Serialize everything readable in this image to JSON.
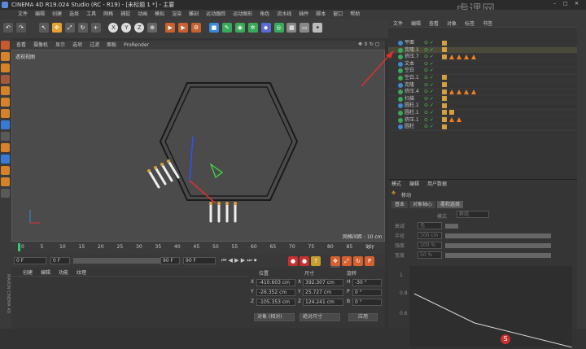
{
  "app": {
    "title": "CINEMA 4D R19.024 Studio (RC - R19) - [未标题 1 *] - 主要"
  },
  "watermark": "虎课网",
  "menu": [
    "文件",
    "编辑",
    "创建",
    "选择",
    "工具",
    "网格",
    "捕捉",
    "动画",
    "模拟",
    "渲染",
    "雕刻",
    "运动跟踪",
    "运动图形",
    "角色",
    "流水线",
    "插件",
    "脚本",
    "窗口",
    "帮助"
  ],
  "viewport": {
    "menu": [
      "查看",
      "摄像机",
      "显示",
      "选项",
      "过滤",
      "面板",
      "ProRender"
    ],
    "label": "透视视图",
    "grid_label": "网格间距 : 10 cm"
  },
  "timeline": {
    "ticks": [
      "0",
      "5",
      "10",
      "15",
      "20",
      "25",
      "30",
      "35",
      "40",
      "45",
      "50",
      "55",
      "60",
      "65",
      "70",
      "75",
      "80",
      "85",
      "90"
    ],
    "right_label": "0 F"
  },
  "playbar": {
    "start": "0 F",
    "current": "0 F",
    "end": "90 F",
    "end2": "90 F"
  },
  "materials": {
    "tabs": [
      "创建",
      "编辑",
      "功能",
      "纹理"
    ]
  },
  "coords": {
    "headers": [
      "位置",
      "尺寸",
      "旋转"
    ],
    "rows": [
      {
        "axis": "X",
        "pos": "-410.603 cm",
        "size": "392.307 cm",
        "rot_axis": "H",
        "rot": "-30 °"
      },
      {
        "axis": "Y",
        "pos": "-26.352 cm",
        "size": "25.727 cm",
        "rot_axis": "P",
        "rot": "0 °"
      },
      {
        "axis": "Z",
        "pos": "-105.353 cm",
        "size": "124.241 cm",
        "rot_axis": "B",
        "rot": "0 °"
      }
    ],
    "mode": "对象 (相对)",
    "size_mode": "绝对尺寸",
    "apply": "应用"
  },
  "objects": {
    "tabs": [
      "文件",
      "编辑",
      "查看",
      "对象",
      "标签",
      "书签"
    ],
    "rows": [
      {
        "name": "平面",
        "tags": "chk"
      },
      {
        "name": "克隆.1",
        "tags": "chk"
      },
      {
        "name": "挤压.7",
        "tags": "tri4"
      },
      {
        "name": "文本",
        "tags": ""
      },
      {
        "name": "空白",
        "tags": ""
      },
      {
        "name": "空白.1",
        "tags": "chk"
      },
      {
        "name": "克隆",
        "tags": "chk"
      },
      {
        "name": "挤压.4",
        "tags": "tri4"
      },
      {
        "name": "扫描",
        "tags": "chk"
      },
      {
        "name": "圆柱.1",
        "tags": "chk"
      },
      {
        "name": "圆柱.1",
        "tags": "chk2"
      },
      {
        "name": "挤压.1",
        "tags": "tri2"
      },
      {
        "name": "圆柱",
        "tags": "chk"
      }
    ]
  },
  "attributes": {
    "tabs": [
      "模式",
      "编辑",
      "用户数据"
    ],
    "title": "移动",
    "subtabs": [
      "基本",
      "对象轴心",
      "柔和选择"
    ],
    "fields": [
      {
        "label": "衰减",
        "value": "无"
      },
      {
        "label": "半径",
        "value": "100 cm"
      },
      {
        "label": "强度",
        "value": "100 %"
      },
      {
        "label": "宽度",
        "value": "50 %"
      }
    ],
    "mode_label": "模式",
    "mode_value": "群组",
    "graph_labels": [
      "1",
      "0.8",
      "0.6"
    ]
  },
  "taskbar_label": "S"
}
